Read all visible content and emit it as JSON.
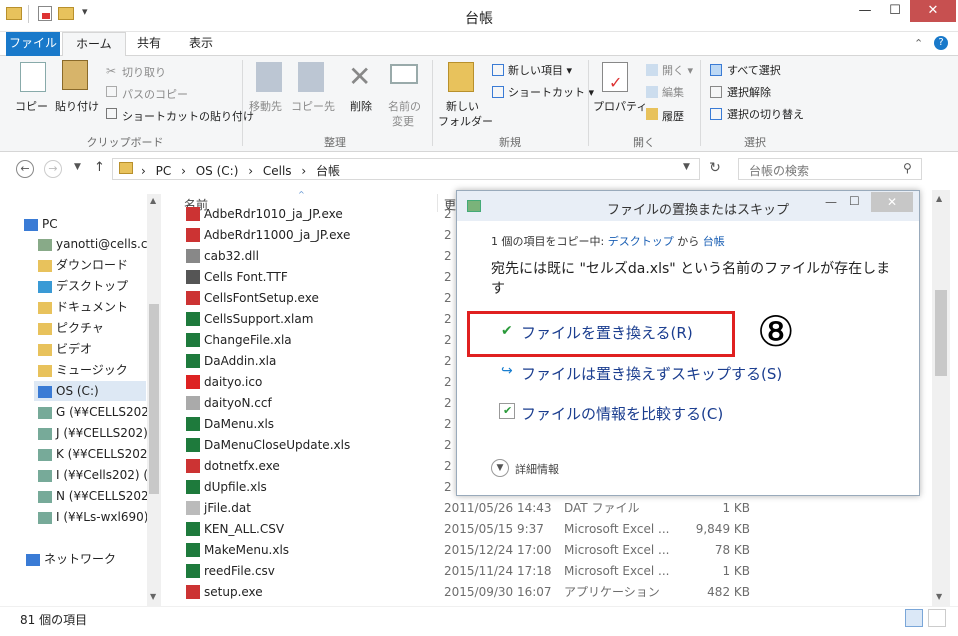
{
  "window": {
    "title": "台帳",
    "min": "—",
    "max": "☐",
    "close": "✕"
  },
  "qat": {
    "dropdown": "▾"
  },
  "tabs": [
    {
      "label": "ファイル"
    },
    {
      "label": "ホーム"
    },
    {
      "label": "共有"
    },
    {
      "label": "表示"
    }
  ],
  "ribbon": {
    "clipboard": {
      "copy": "コピー",
      "paste": "貼り付け",
      "cut": "切り取り",
      "copy_path": "パスのコピー",
      "paste_shortcut": "ショートカットの貼り付け",
      "label": "クリップボード"
    },
    "organize": {
      "move": "移動先",
      "copyto": "コピー先",
      "delete": "削除",
      "rename1": "名前の",
      "rename2": "変更",
      "label": "整理"
    },
    "new": {
      "newfolder1": "新しい",
      "newfolder2": "フォルダー",
      "newitem": "新しい項目 ▾",
      "shortcut": "ショートカット ▾",
      "label": "新規"
    },
    "open": {
      "properties": "プロパティ",
      "open": "開く ▾",
      "edit": "編集",
      "history": "履歴",
      "label": "開く"
    },
    "select": {
      "all": "すべて選択",
      "none": "選択解除",
      "invert": "選択の切り替え",
      "label": "選択"
    }
  },
  "address": {
    "path": [
      "PC",
      "OS (C:)",
      "Cells",
      "台帳"
    ],
    "sep": "›",
    "search_placeholder": "台帳の検索"
  },
  "nav": {
    "items": [
      {
        "label": "PC"
      },
      {
        "label": "yanotti@cells.c"
      },
      {
        "label": "ダウンロード"
      },
      {
        "label": "デスクトップ"
      },
      {
        "label": "ドキュメント"
      },
      {
        "label": "ピクチャ"
      },
      {
        "label": "ビデオ"
      },
      {
        "label": "ミュージック"
      },
      {
        "label": "OS (C:)"
      },
      {
        "label": "G (¥¥CELLS202"
      },
      {
        "label": "J (¥¥CELLS202)"
      },
      {
        "label": "K (¥¥CELLS202"
      },
      {
        "label": "I (¥¥Cells202) ("
      },
      {
        "label": "N (¥¥CELLS202"
      },
      {
        "label": "I (¥¥Ls-wxl690)"
      },
      {
        "label": "ネットワーク"
      }
    ]
  },
  "columns": {
    "name": "名前",
    "date": "更"
  },
  "files": [
    {
      "name": "AdbeRdr1010_ja_JP.exe",
      "date": "2",
      "type": "",
      "size": ""
    },
    {
      "name": "AdbeRdr11000_ja_JP.exe",
      "date": "2",
      "type": "",
      "size": ""
    },
    {
      "name": "cab32.dll",
      "date": "2",
      "type": "",
      "size": ""
    },
    {
      "name": "Cells Font.TTF",
      "date": "2",
      "type": "",
      "size": ""
    },
    {
      "name": "CellsFontSetup.exe",
      "date": "2",
      "type": "",
      "size": ""
    },
    {
      "name": "CellsSupport.xlam",
      "date": "2",
      "type": "",
      "size": ""
    },
    {
      "name": "ChangeFile.xla",
      "date": "2",
      "type": "",
      "size": ""
    },
    {
      "name": "DaAddin.xla",
      "date": "2",
      "type": "",
      "size": ""
    },
    {
      "name": "daityo.ico",
      "date": "2",
      "type": "",
      "size": ""
    },
    {
      "name": "daityoN.ccf",
      "date": "2",
      "type": "",
      "size": ""
    },
    {
      "name": "DaMenu.xls",
      "date": "2",
      "type": "",
      "size": ""
    },
    {
      "name": "DaMenuCloseUpdate.xls",
      "date": "2",
      "type": "",
      "size": ""
    },
    {
      "name": "dotnetfx.exe",
      "date": "2",
      "type": "",
      "size": ""
    },
    {
      "name": "dUpfile.xls",
      "date": "2",
      "type": "",
      "size": ""
    },
    {
      "name": "jFile.dat",
      "date": "2011/05/26 14:43",
      "type": "DAT ファイル",
      "size": "1 KB"
    },
    {
      "name": "KEN_ALL.CSV",
      "date": "2015/05/15 9:37",
      "type": "Microsoft Excel ...",
      "size": "9,849 KB"
    },
    {
      "name": "MakeMenu.xls",
      "date": "2015/12/24 17:00",
      "type": "Microsoft Excel ...",
      "size": "78 KB"
    },
    {
      "name": "reedFile.csv",
      "date": "2015/11/24 17:18",
      "type": "Microsoft Excel ...",
      "size": "1 KB"
    },
    {
      "name": "setup.exe",
      "date": "2015/09/30 16:07",
      "type": "アプリケーション",
      "size": "482 KB"
    }
  ],
  "status": {
    "count": "81 個の項目"
  },
  "dialog": {
    "title": "ファイルの置換またはスキップ",
    "copy_prefix": "1 個の項目をコピー中: ",
    "copy_from": "デスクトップ",
    "copy_mid": " から ",
    "copy_to": "台帳",
    "message": "宛先には既に \"セルズda.xls\" という名前のファイルが存在します",
    "replace": "ファイルを置き換える(R)",
    "skip": "ファイルは置き換えずスキップする(S)",
    "compare": "ファイルの情報を比較する(C)",
    "details": "詳細情報",
    "annotation": "⑧"
  },
  "colors": {
    "accent": "#1979ca",
    "highlight": "#e02020",
    "link": "#1a5fb4"
  }
}
